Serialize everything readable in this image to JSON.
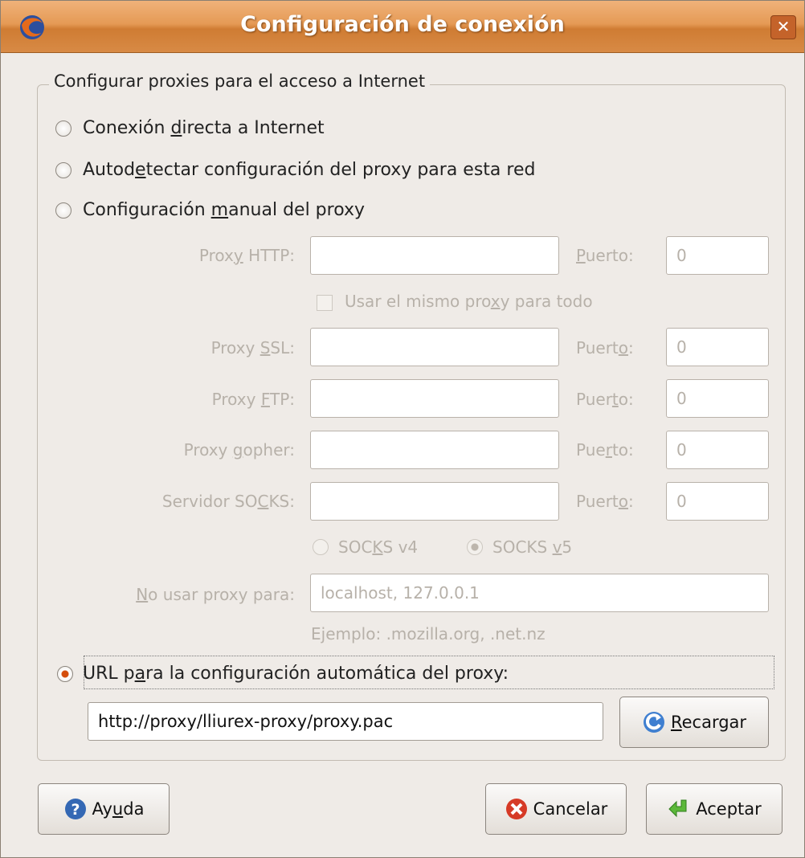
{
  "window": {
    "title": "Configuración de conexión"
  },
  "group": {
    "legend": "Configurar proxies para el acceso a Internet"
  },
  "options": {
    "direct": {
      "pre": "Conexión ",
      "key": "d",
      "post": "irecta a Internet"
    },
    "autodetect": {
      "pre": "Autod",
      "key": "e",
      "post": "tectar configuración del proxy para esta red"
    },
    "manual": {
      "pre": "Configuración ",
      "key": "m",
      "post": "anual del proxy"
    },
    "auto_url": {
      "pre": "URL p",
      "key": "a",
      "post": "ra la configuración automática del proxy:"
    }
  },
  "proxies": {
    "http": {
      "lpre": "Prox",
      "lkey": "y",
      "lpost": " HTTP:",
      "ppre": "",
      "pkey": "P",
      "ppost": "uerto:",
      "host": "",
      "port": "0"
    },
    "same": {
      "pre": "Usar el mismo pro",
      "key": "x",
      "post": "y para todo"
    },
    "ssl": {
      "lpre": "Proxy ",
      "lkey": "S",
      "lpost": "SL:",
      "ppre": "Puert",
      "pkey": "o",
      "ppost": ":",
      "host": "",
      "port": "0"
    },
    "ftp": {
      "lpre": "Proxy ",
      "lkey": "F",
      "lpost": "TP:",
      "ppre": "Puer",
      "pkey": "t",
      "ppost": "o:",
      "host": "",
      "port": "0"
    },
    "gopher": {
      "lpre": "Proxy ",
      "lkey": "g",
      "lpost": "opher:",
      "ppre": "Pue",
      "pkey": "r",
      "ppost": "to:",
      "host": "",
      "port": "0"
    },
    "socks": {
      "lpre": "Servidor SO",
      "lkey": "C",
      "lpost": "KS:",
      "ppre": "Puert",
      "pkey": "o",
      "ppost": ":",
      "host": "",
      "port": "0"
    },
    "socks_v4": {
      "pre": "SOC",
      "key": "K",
      "post": "S v4"
    },
    "socks_v5": {
      "pre": "SOCKS ",
      "key": "v",
      "post": "5"
    },
    "no_proxy": {
      "lpre": "",
      "lkey": "N",
      "lpost": "o usar proxy para:",
      "value": "localhost, 127.0.0.1"
    },
    "example": "Ejemplo: .mozilla.org, .net.nz"
  },
  "auto_url": {
    "value": "http://proxy/lliurex-proxy/proxy.pac"
  },
  "buttons": {
    "reload": {
      "pre": "",
      "key": "R",
      "post": "ecargar"
    },
    "help": {
      "pre": "Ay",
      "key": "u",
      "post": "da"
    },
    "cancel": {
      "label": "Cancelar"
    },
    "accept": {
      "label": "Aceptar"
    }
  },
  "colors": {
    "titlebar": "#e59a55",
    "accent": "#d44c0a",
    "disabled_text": "#b7b1a9"
  },
  "state": {
    "selected_mode": "auto_url"
  }
}
